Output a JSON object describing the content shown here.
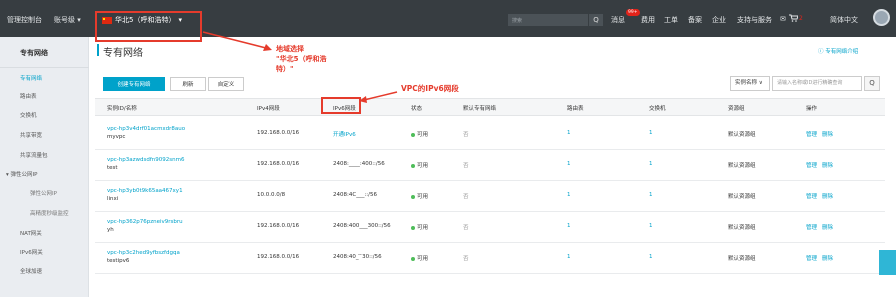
{
  "topbar": {
    "console": "管理控制台",
    "account": "账号级 ▾",
    "region": "华北5（呼和浩特）",
    "region_caret": "▾",
    "search_placeholder": "搜索",
    "search_icon": "Q",
    "messages": "消息",
    "messages_badge": "99+",
    "billing": "费用",
    "tickets": "工单",
    "filing": "备案",
    "enterprise": "企业",
    "support": "支持与服务",
    "mail_icon": "✉",
    "cart_icon": "🛒",
    "cart_count": "2",
    "language": "简体中文"
  },
  "sidebar": {
    "title": "专有网络",
    "items": [
      {
        "label": "专有网络",
        "active": true
      },
      {
        "label": "路由表"
      },
      {
        "label": "交换机"
      },
      {
        "label": "共享带宽"
      },
      {
        "label": "共享流量包"
      },
      {
        "label": "▾ 弹性公网IP"
      },
      {
        "label": "弹性公网IP",
        "sub": true
      },
      {
        "label": "高精度秒级监控",
        "sub": true
      },
      {
        "label": "NAT网关"
      },
      {
        "label": "IPv6网关"
      },
      {
        "label": "全球加速"
      }
    ]
  },
  "main": {
    "title": "专有网络",
    "help_link": "ⓘ 专有网络介绍",
    "buttons": {
      "create": "创建专有网络",
      "refresh": "刷新",
      "custom": "自定义"
    },
    "filter_select": "实例名称 ∨",
    "filter_placeholder": "请输入名称或ID进行精确查询",
    "filter_icon": "Q"
  },
  "table": {
    "headers": [
      "实例ID/名称",
      "IPv4网段",
      "IPv6网段",
      "状态",
      "默认专有网络",
      "路由表",
      "交换机",
      "资源组",
      "操作"
    ],
    "rows": [
      {
        "id": "vpc-hp3v4drf01acmxdr8auo",
        "name": "myvpc",
        "ipv4": "192.168.0.0/16",
        "ipv6": "开通IPv6",
        "status": "可用",
        "default": "否",
        "route": "1",
        "vswitch": "1",
        "rg": "默认资源组",
        "manage": "管理",
        "delete": "删除"
      },
      {
        "id": "vpc-hp3azwdsdfn9092snm6",
        "name": "test",
        "ipv4": "192.168.0.0/16",
        "ipv6": "2408:____:400::/56",
        "status": "可用",
        "default": "否",
        "route": "1",
        "vswitch": "1",
        "rg": "默认资源组",
        "manage": "管理",
        "delete": "删除"
      },
      {
        "id": "vpc-hp3yb0t9k65aa467xy1",
        "name": "linxi",
        "ipv4": "10.0.0.0/8",
        "ipv6": "2408:4C___::/56",
        "status": "可用",
        "default": "否",
        "route": "1",
        "vswitch": "1",
        "rg": "默认资源组",
        "manage": "管理",
        "delete": "删除"
      },
      {
        "id": "vpc-hp362p76pzneiv9rsbru",
        "name": "yh",
        "ipv4": "192.168.0.0/16",
        "ipv6": "2408:400___300::/56",
        "status": "可用",
        "default": "否",
        "route": "1",
        "vswitch": "1",
        "rg": "默认资源组",
        "manage": "管理",
        "delete": "删除"
      },
      {
        "id": "vpc-hp3c2hed9yfbszfdgqa",
        "name": "testipv6",
        "ipv4": "192.168.0.0/16",
        "ipv6": "2408:40_ ̄ ̄30::/56",
        "status": "可用",
        "default": "否",
        "route": "1",
        "vswitch": "1",
        "rg": "默认资源组",
        "manage": "管理",
        "delete": "删除"
      }
    ]
  },
  "annotations": {
    "region_line1": "地域选择",
    "region_line2": "\"华北5（呼和浩",
    "region_line3": "特）\"",
    "ipv6": "VPC的IPv6网段"
  },
  "colors": {
    "accent": "#00a2ca",
    "topbar": "#373d41",
    "annotation": "#e53b2c",
    "status_ok": "#4fbd5a"
  }
}
